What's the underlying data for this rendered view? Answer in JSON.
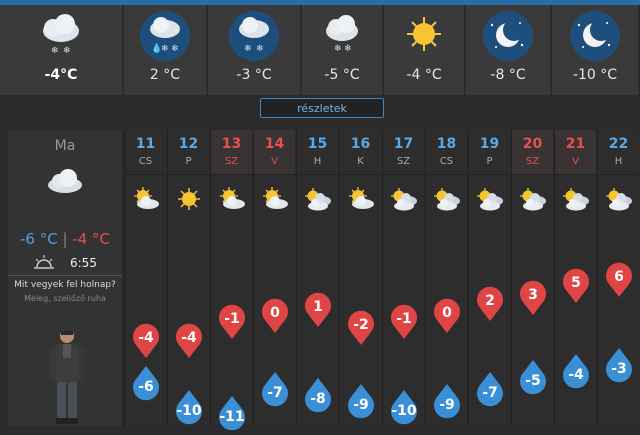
{
  "hourly": [
    {
      "temp": "-4°C",
      "icon": "snow-cloud-icon",
      "bold": true
    },
    {
      "temp": "2 °C",
      "icon": "rain-snow-cloud-icon"
    },
    {
      "temp": "-3 °C",
      "icon": "snow-cloud-icon"
    },
    {
      "temp": "-5 °C",
      "icon": "snow-cloud-icon"
    },
    {
      "temp": "-4 °C",
      "icon": "sun-icon"
    },
    {
      "temp": "-8 °C",
      "icon": "moon-stars-icon"
    },
    {
      "temp": "-10 °C",
      "icon": "moon-stars-icon"
    }
  ],
  "details_label": "részletek",
  "today": {
    "label": "Ma",
    "temp_min": "-6 °C",
    "separator": "|",
    "temp_max": "-4 °C",
    "sunrise": "6:55",
    "question": "Mit vegyek fel holnap?",
    "answer": "Meleg, szellőző ruha"
  },
  "days": [
    {
      "num": "11",
      "wd": "CS",
      "weekend": false,
      "max": "-4",
      "min": "-6",
      "icon": "sun-cloud-icon"
    },
    {
      "num": "12",
      "wd": "P",
      "weekend": false,
      "max": "-4",
      "min": "-10",
      "icon": "sun-icon"
    },
    {
      "num": "13",
      "wd": "SZ",
      "weekend": true,
      "max": "-1",
      "min": "-11",
      "icon": "sun-cloud-icon"
    },
    {
      "num": "14",
      "wd": "V",
      "weekend": true,
      "max": "0",
      "min": "-7",
      "icon": "sun-cloud-icon"
    },
    {
      "num": "15",
      "wd": "H",
      "weekend": false,
      "max": "1",
      "min": "-8",
      "icon": "sun-clouds-icon"
    },
    {
      "num": "16",
      "wd": "K",
      "weekend": false,
      "max": "-2",
      "min": "-9",
      "icon": "sun-cloud-icon"
    },
    {
      "num": "17",
      "wd": "SZ",
      "weekend": false,
      "max": "-1",
      "min": "-10",
      "icon": "sun-clouds-icon"
    },
    {
      "num": "18",
      "wd": "CS",
      "weekend": false,
      "max": "0",
      "min": "-9",
      "icon": "sun-clouds-icon"
    },
    {
      "num": "19",
      "wd": "P",
      "weekend": false,
      "max": "2",
      "min": "-7",
      "icon": "sun-clouds-icon"
    },
    {
      "num": "20",
      "wd": "SZ",
      "weekend": true,
      "max": "3",
      "min": "-5",
      "icon": "sun-clouds-icon"
    },
    {
      "num": "21",
      "wd": "V",
      "weekend": true,
      "max": "5",
      "min": "-4",
      "icon": "sun-clouds-icon"
    },
    {
      "num": "22",
      "wd": "H",
      "weekend": false,
      "max": "6",
      "min": "-3",
      "icon": "sun-clouds-icon"
    }
  ],
  "colors": {
    "max_pin": "#e04545",
    "min_pin": "#3a8fd6",
    "accent": "#2a6ea8"
  }
}
